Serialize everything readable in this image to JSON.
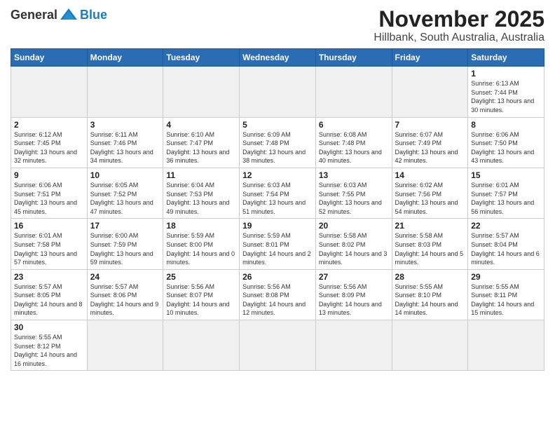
{
  "logo": {
    "general": "General",
    "blue": "Blue"
  },
  "title": "November 2025",
  "location": "Hillbank, South Australia, Australia",
  "weekdays": [
    "Sunday",
    "Monday",
    "Tuesday",
    "Wednesday",
    "Thursday",
    "Friday",
    "Saturday"
  ],
  "weeks": [
    [
      {
        "day": "",
        "empty": true
      },
      {
        "day": "",
        "empty": true
      },
      {
        "day": "",
        "empty": true
      },
      {
        "day": "",
        "empty": true
      },
      {
        "day": "",
        "empty": true
      },
      {
        "day": "",
        "empty": true
      },
      {
        "day": "1",
        "sunrise": "Sunrise: 6:13 AM",
        "sunset": "Sunset: 7:44 PM",
        "daylight": "Daylight: 13 hours and 30 minutes."
      }
    ],
    [
      {
        "day": "2",
        "sunrise": "Sunrise: 6:12 AM",
        "sunset": "Sunset: 7:45 PM",
        "daylight": "Daylight: 13 hours and 32 minutes."
      },
      {
        "day": "3",
        "sunrise": "Sunrise: 6:11 AM",
        "sunset": "Sunset: 7:46 PM",
        "daylight": "Daylight: 13 hours and 34 minutes."
      },
      {
        "day": "4",
        "sunrise": "Sunrise: 6:10 AM",
        "sunset": "Sunset: 7:47 PM",
        "daylight": "Daylight: 13 hours and 36 minutes."
      },
      {
        "day": "5",
        "sunrise": "Sunrise: 6:09 AM",
        "sunset": "Sunset: 7:48 PM",
        "daylight": "Daylight: 13 hours and 38 minutes."
      },
      {
        "day": "6",
        "sunrise": "Sunrise: 6:08 AM",
        "sunset": "Sunset: 7:48 PM",
        "daylight": "Daylight: 13 hours and 40 minutes."
      },
      {
        "day": "7",
        "sunrise": "Sunrise: 6:07 AM",
        "sunset": "Sunset: 7:49 PM",
        "daylight": "Daylight: 13 hours and 42 minutes."
      },
      {
        "day": "8",
        "sunrise": "Sunrise: 6:06 AM",
        "sunset": "Sunset: 7:50 PM",
        "daylight": "Daylight: 13 hours and 43 minutes."
      }
    ],
    [
      {
        "day": "9",
        "sunrise": "Sunrise: 6:06 AM",
        "sunset": "Sunset: 7:51 PM",
        "daylight": "Daylight: 13 hours and 45 minutes."
      },
      {
        "day": "10",
        "sunrise": "Sunrise: 6:05 AM",
        "sunset": "Sunset: 7:52 PM",
        "daylight": "Daylight: 13 hours and 47 minutes."
      },
      {
        "day": "11",
        "sunrise": "Sunrise: 6:04 AM",
        "sunset": "Sunset: 7:53 PM",
        "daylight": "Daylight: 13 hours and 49 minutes."
      },
      {
        "day": "12",
        "sunrise": "Sunrise: 6:03 AM",
        "sunset": "Sunset: 7:54 PM",
        "daylight": "Daylight: 13 hours and 51 minutes."
      },
      {
        "day": "13",
        "sunrise": "Sunrise: 6:03 AM",
        "sunset": "Sunset: 7:55 PM",
        "daylight": "Daylight: 13 hours and 52 minutes."
      },
      {
        "day": "14",
        "sunrise": "Sunrise: 6:02 AM",
        "sunset": "Sunset: 7:56 PM",
        "daylight": "Daylight: 13 hours and 54 minutes."
      },
      {
        "day": "15",
        "sunrise": "Sunrise: 6:01 AM",
        "sunset": "Sunset: 7:57 PM",
        "daylight": "Daylight: 13 hours and 56 minutes."
      }
    ],
    [
      {
        "day": "16",
        "sunrise": "Sunrise: 6:01 AM",
        "sunset": "Sunset: 7:58 PM",
        "daylight": "Daylight: 13 hours and 57 minutes."
      },
      {
        "day": "17",
        "sunrise": "Sunrise: 6:00 AM",
        "sunset": "Sunset: 7:59 PM",
        "daylight": "Daylight: 13 hours and 59 minutes."
      },
      {
        "day": "18",
        "sunrise": "Sunrise: 5:59 AM",
        "sunset": "Sunset: 8:00 PM",
        "daylight": "Daylight: 14 hours and 0 minutes."
      },
      {
        "day": "19",
        "sunrise": "Sunrise: 5:59 AM",
        "sunset": "Sunset: 8:01 PM",
        "daylight": "Daylight: 14 hours and 2 minutes."
      },
      {
        "day": "20",
        "sunrise": "Sunrise: 5:58 AM",
        "sunset": "Sunset: 8:02 PM",
        "daylight": "Daylight: 14 hours and 3 minutes."
      },
      {
        "day": "21",
        "sunrise": "Sunrise: 5:58 AM",
        "sunset": "Sunset: 8:03 PM",
        "daylight": "Daylight: 14 hours and 5 minutes."
      },
      {
        "day": "22",
        "sunrise": "Sunrise: 5:57 AM",
        "sunset": "Sunset: 8:04 PM",
        "daylight": "Daylight: 14 hours and 6 minutes."
      }
    ],
    [
      {
        "day": "23",
        "sunrise": "Sunrise: 5:57 AM",
        "sunset": "Sunset: 8:05 PM",
        "daylight": "Daylight: 14 hours and 8 minutes."
      },
      {
        "day": "24",
        "sunrise": "Sunrise: 5:57 AM",
        "sunset": "Sunset: 8:06 PM",
        "daylight": "Daylight: 14 hours and 9 minutes."
      },
      {
        "day": "25",
        "sunrise": "Sunrise: 5:56 AM",
        "sunset": "Sunset: 8:07 PM",
        "daylight": "Daylight: 14 hours and 10 minutes."
      },
      {
        "day": "26",
        "sunrise": "Sunrise: 5:56 AM",
        "sunset": "Sunset: 8:08 PM",
        "daylight": "Daylight: 14 hours and 12 minutes."
      },
      {
        "day": "27",
        "sunrise": "Sunrise: 5:56 AM",
        "sunset": "Sunset: 8:09 PM",
        "daylight": "Daylight: 14 hours and 13 minutes."
      },
      {
        "day": "28",
        "sunrise": "Sunrise: 5:55 AM",
        "sunset": "Sunset: 8:10 PM",
        "daylight": "Daylight: 14 hours and 14 minutes."
      },
      {
        "day": "29",
        "sunrise": "Sunrise: 5:55 AM",
        "sunset": "Sunset: 8:11 PM",
        "daylight": "Daylight: 14 hours and 15 minutes."
      }
    ],
    [
      {
        "day": "30",
        "sunrise": "Sunrise: 5:55 AM",
        "sunset": "Sunset: 8:12 PM",
        "daylight": "Daylight: 14 hours and 16 minutes.",
        "last": true
      },
      {
        "day": "",
        "empty": true,
        "last": true
      },
      {
        "day": "",
        "empty": true,
        "last": true
      },
      {
        "day": "",
        "empty": true,
        "last": true
      },
      {
        "day": "",
        "empty": true,
        "last": true
      },
      {
        "day": "",
        "empty": true,
        "last": true
      },
      {
        "day": "",
        "empty": true,
        "last": true
      }
    ]
  ]
}
